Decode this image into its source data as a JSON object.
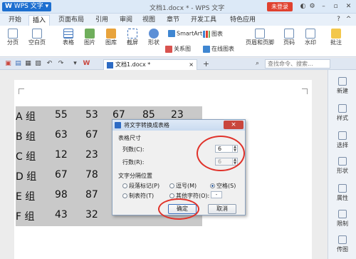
{
  "app": {
    "logo": "W",
    "name": "WPS 文字",
    "window_title": "文档1.docx * - WPS 文字",
    "login_label": "未登录"
  },
  "ribbon_tabs": [
    "开始",
    "插入",
    "页面布局",
    "引用",
    "审阅",
    "视图",
    "章节",
    "开发工具",
    "特色应用"
  ],
  "active_tab": "插入",
  "ribbon": {
    "page_break": "分页",
    "blank_page": "空白页",
    "table": "表格",
    "picture": "图片",
    "gallery": "图库",
    "screenshot": "截屏",
    "shapes": "形状",
    "relation_graph": "关系图",
    "smartart": "SmartArt",
    "chart": "图表",
    "online_chart": "在线图表",
    "header_footer": "页眉和页脚",
    "page_number": "页码",
    "watermark": "水印",
    "comment": "批注"
  },
  "doc_tab": {
    "name": "文档1.docx *"
  },
  "command_search": {
    "placeholder": "查找命令、搜索..."
  },
  "table_rows": [
    {
      "label": "A 组",
      "values": [
        "55",
        "53",
        "67",
        "85",
        "23"
      ]
    },
    {
      "label": "B 组",
      "values": [
        "63",
        "67"
      ]
    },
    {
      "label": "C 组",
      "values": [
        "12",
        "23"
      ]
    },
    {
      "label": "D 组",
      "values": [
        "67",
        "78"
      ]
    },
    {
      "label": "E 组",
      "values": [
        "98",
        "87"
      ]
    },
    {
      "label": "F 组",
      "values": [
        "43",
        "32"
      ]
    }
  ],
  "sidebar": [
    "新建",
    "样式",
    "选择",
    "形状",
    "属性",
    "限制",
    "传图"
  ],
  "dialog": {
    "title": "将文字转换成表格",
    "close": "×",
    "table_size_heading": "表格尺寸",
    "columns_label": "列数(C):",
    "columns_value": "6",
    "rows_label": "行数(R):",
    "rows_value": "6",
    "separator_heading": "文字分隔位置",
    "opt_paragraph": "段落标记(P)",
    "opt_comma": "逗号(M)",
    "opt_space": "空格(S)",
    "opt_tab": "制表符(T)",
    "opt_other": "其他字符(O):",
    "other_value": "-",
    "selected_option": "opt_space",
    "ok": "确定",
    "cancel": "取消"
  },
  "colors": {
    "accent": "#1d6fd0",
    "annotation": "#e0322a",
    "selection": "#c9c9c9"
  }
}
